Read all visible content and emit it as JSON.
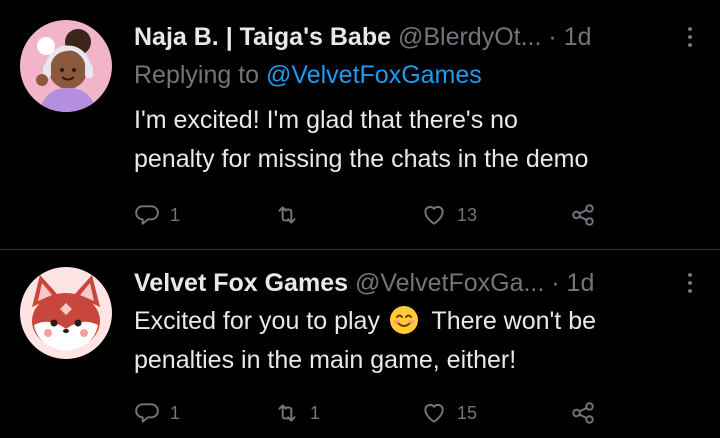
{
  "tweets": [
    {
      "author_name": "Naja B. | Taiga's Babe",
      "handle": "@BlerdyOt...",
      "separator": "·",
      "time": "1d",
      "replying_prefix": "Replying to",
      "replying_to": "@VelvetFoxGames",
      "text_lines": [
        "I'm excited! I'm glad that there's no",
        "penalty for missing the chats in the demo"
      ],
      "reply_count": "1",
      "retweet_count": "",
      "like_count": "13"
    },
    {
      "author_name": "Velvet Fox Games",
      "handle": "@VelvetFoxGa...",
      "separator": "·",
      "time": "1d",
      "text_part1": "Excited for you to play",
      "emoji": "smiling-face-with-smiling-eyes",
      "text_part2": "There won't be",
      "text_line2": "penalties in the main game, either!",
      "reply_count": "1",
      "retweet_count": "1",
      "like_count": "15"
    }
  ],
  "colors": {
    "background": "#000000",
    "primary_text": "#e7e9ea",
    "secondary_text": "#71767b",
    "link": "#1d9bf0",
    "divider": "#2f3336"
  },
  "icons": {
    "reply": "reply-icon",
    "retweet": "retweet-icon",
    "like": "like-icon",
    "share": "share-icon",
    "more": "more-icon"
  }
}
